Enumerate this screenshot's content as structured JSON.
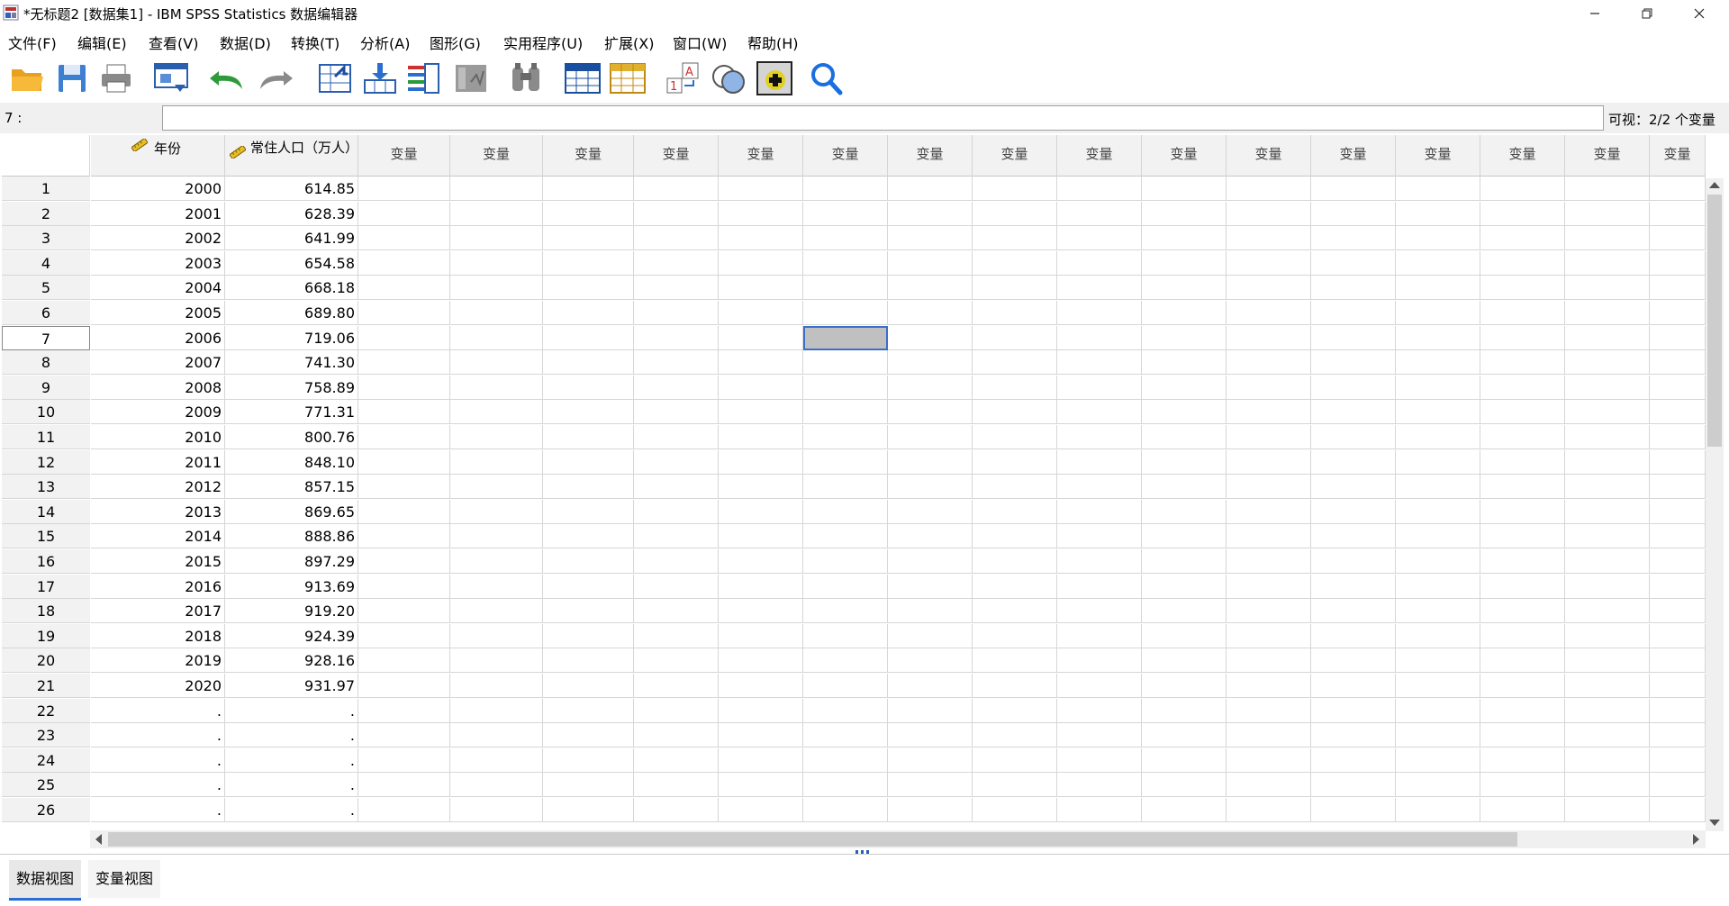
{
  "window": {
    "title": "*无标题2 [数据集1] - IBM SPSS Statistics 数据编辑器"
  },
  "menu": [
    "文件(F)",
    "编辑(E)",
    "查看(V)",
    "数据(D)",
    "转换(T)",
    "分析(A)",
    "图形(G)",
    "实用程序(U)",
    "扩展(X)",
    "窗口(W)",
    "帮助(H)"
  ],
  "toolbar": {
    "icons": [
      "open-folder-icon",
      "save-icon",
      "print-icon",
      "recall-dialog-icon",
      "undo-icon",
      "redo-icon",
      "goto-case-icon",
      "goto-variable-icon",
      "variables-icon",
      "run-descriptive-icon",
      "find-icon",
      "insert-cases-icon",
      "insert-variable-icon",
      "split-file-icon",
      "weight-cases-icon",
      "select-cases-icon",
      "value-labels-icon",
      "use-variable-sets-icon",
      "search-icon"
    ]
  },
  "cellbar": {
    "ref": "7 :",
    "value": "",
    "visible": "可视：2/2 个变量"
  },
  "columns": [
    {
      "name": "年份",
      "type": "scale"
    },
    {
      "name": "常住人口（万人）",
      "type": "scale"
    }
  ],
  "empty_column_label": "变量",
  "rows": [
    [
      "1",
      "2000",
      "614.85"
    ],
    [
      "2",
      "2001",
      "628.39"
    ],
    [
      "3",
      "2002",
      "641.99"
    ],
    [
      "4",
      "2003",
      "654.58"
    ],
    [
      "5",
      "2004",
      "668.18"
    ],
    [
      "6",
      "2005",
      "689.80"
    ],
    [
      "7",
      "2006",
      "719.06"
    ],
    [
      "8",
      "2007",
      "741.30"
    ],
    [
      "9",
      "2008",
      "758.89"
    ],
    [
      "10",
      "2009",
      "771.31"
    ],
    [
      "11",
      "2010",
      "800.76"
    ],
    [
      "12",
      "2011",
      "848.10"
    ],
    [
      "13",
      "2012",
      "857.15"
    ],
    [
      "14",
      "2013",
      "869.65"
    ],
    [
      "15",
      "2014",
      "888.86"
    ],
    [
      "16",
      "2015",
      "897.29"
    ],
    [
      "17",
      "2016",
      "913.69"
    ],
    [
      "18",
      "2017",
      "919.20"
    ],
    [
      "19",
      "2018",
      "924.39"
    ],
    [
      "20",
      "2019",
      "928.16"
    ],
    [
      "21",
      "2020",
      "931.97"
    ],
    [
      "22",
      ".",
      "."
    ],
    [
      "23",
      ".",
      "."
    ],
    [
      "24",
      ".",
      "."
    ],
    [
      "25",
      ".",
      "."
    ],
    [
      "26",
      ".",
      "."
    ]
  ],
  "selected": {
    "row": "7",
    "column": 6
  },
  "tabs": [
    {
      "label": "数据视图",
      "active": true
    },
    {
      "label": "变量视图",
      "active": false
    }
  ],
  "colors": {
    "selected_cell": "#c0c0c0",
    "selected_border": "#3a6ec8",
    "tab_active_underline": "#2b6cd6"
  }
}
